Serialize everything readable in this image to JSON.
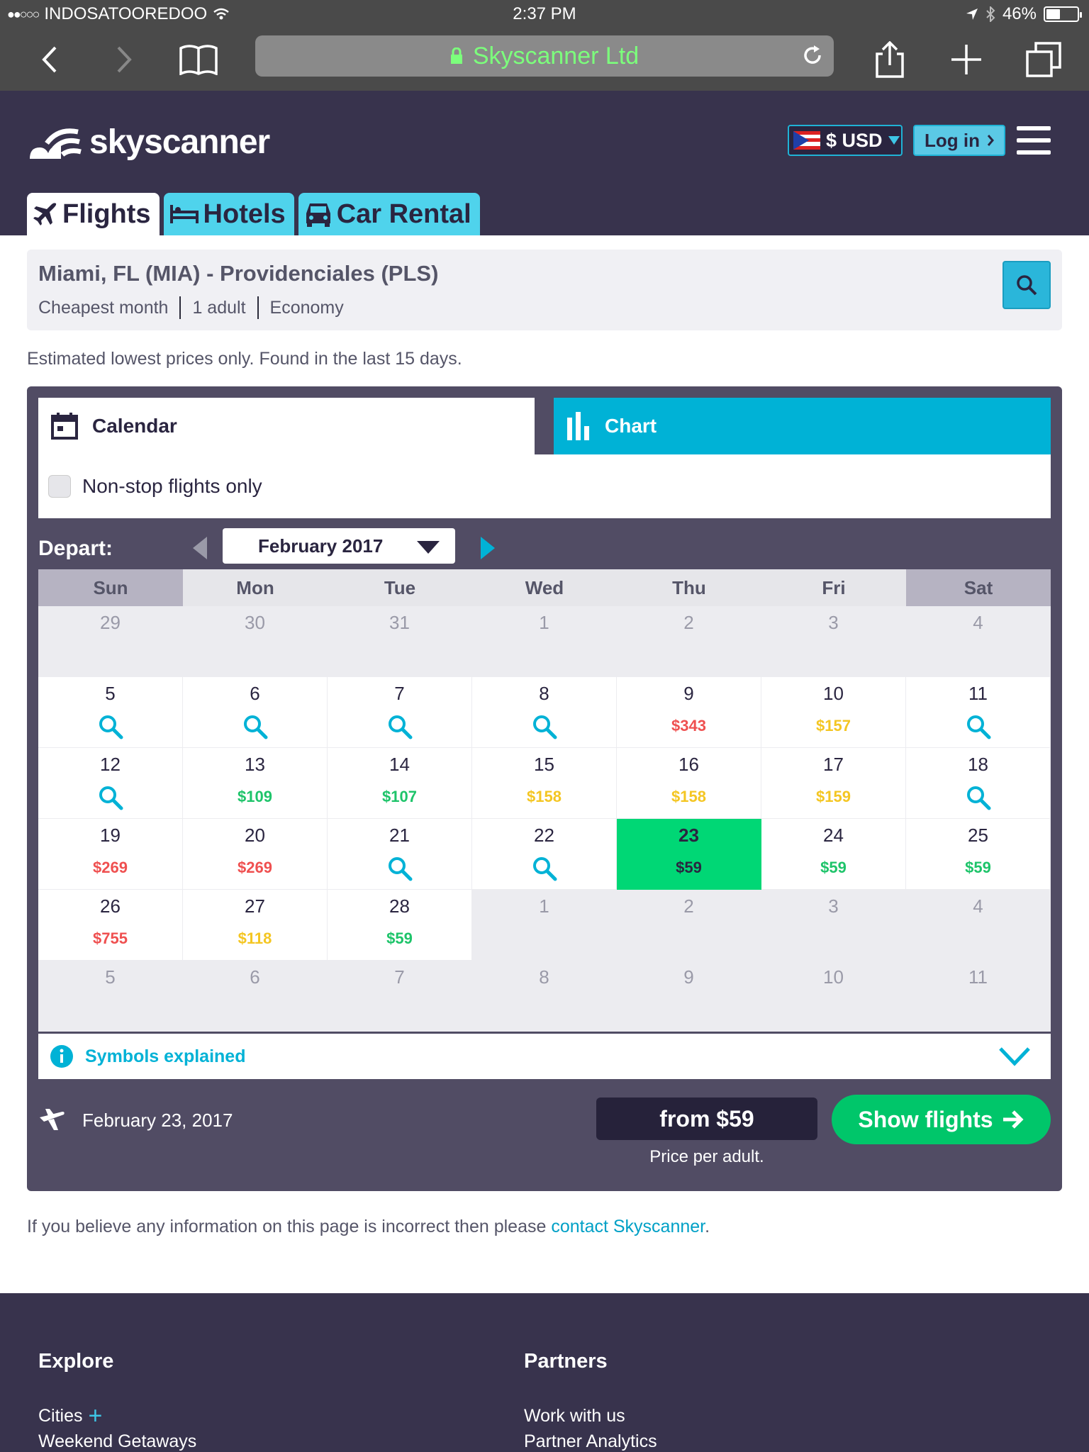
{
  "status": {
    "carrier": "INDOSATOOREDOO",
    "time": "2:37 PM",
    "battery": "46%",
    "battery_level": 0.46
  },
  "browser": {
    "url_title": "Skyscanner Ltd"
  },
  "header": {
    "logo_text": "skyscanner",
    "currency_label": "$ USD",
    "login_label": "Log in",
    "tabs": [
      {
        "label": "Flights",
        "active": true
      },
      {
        "label": "Hotels",
        "active": false
      },
      {
        "label": "Car Rental",
        "active": false
      }
    ]
  },
  "search": {
    "route": "Miami, FL (MIA) - Providenciales (PLS)",
    "when": "Cheapest month",
    "travellers": "1 adult",
    "cabin": "Economy"
  },
  "estimate_note": "Estimated lowest prices only. Found in the last 15 days.",
  "view_tabs": {
    "calendar": "Calendar",
    "chart": "Chart"
  },
  "nonstop_label": "Non-stop flights only",
  "calendar": {
    "depart_label": "Depart:",
    "month": "February 2017",
    "days_of_week": [
      "Sun",
      "Mon",
      "Tue",
      "Wed",
      "Thu",
      "Fri",
      "Sat"
    ],
    "weeks": [
      [
        {
          "day": "29",
          "other": true
        },
        {
          "day": "30",
          "other": true
        },
        {
          "day": "31",
          "other": true
        },
        {
          "day": "1",
          "other": true
        },
        {
          "day": "2",
          "other": true
        },
        {
          "day": "3",
          "other": true
        },
        {
          "day": "4",
          "other": true
        }
      ],
      [
        {
          "day": "5",
          "search": true
        },
        {
          "day": "6",
          "search": true
        },
        {
          "day": "7",
          "search": true
        },
        {
          "day": "8",
          "search": true
        },
        {
          "day": "9",
          "price": "$343",
          "level": "red"
        },
        {
          "day": "10",
          "price": "$157",
          "level": "yel"
        },
        {
          "day": "11",
          "search": true
        }
      ],
      [
        {
          "day": "12",
          "search": true
        },
        {
          "day": "13",
          "price": "$109",
          "level": "grn"
        },
        {
          "day": "14",
          "price": "$107",
          "level": "grn"
        },
        {
          "day": "15",
          "price": "$158",
          "level": "yel"
        },
        {
          "day": "16",
          "price": "$158",
          "level": "yel"
        },
        {
          "day": "17",
          "price": "$159",
          "level": "yel"
        },
        {
          "day": "18",
          "search": true
        }
      ],
      [
        {
          "day": "19",
          "price": "$269",
          "level": "red"
        },
        {
          "day": "20",
          "price": "$269",
          "level": "red"
        },
        {
          "day": "21",
          "search": true
        },
        {
          "day": "22",
          "search": true
        },
        {
          "day": "23",
          "price": "$59",
          "level": "grn",
          "selected": true
        },
        {
          "day": "24",
          "price": "$59",
          "level": "grn"
        },
        {
          "day": "25",
          "price": "$59",
          "level": "grn"
        }
      ],
      [
        {
          "day": "26",
          "price": "$755",
          "level": "red"
        },
        {
          "day": "27",
          "price": "$118",
          "level": "yel"
        },
        {
          "day": "28",
          "price": "$59",
          "level": "grn"
        },
        {
          "day": "1",
          "other": true
        },
        {
          "day": "2",
          "other": true
        },
        {
          "day": "3",
          "other": true
        },
        {
          "day": "4",
          "other": true
        }
      ],
      [
        {
          "day": "5",
          "other": true
        },
        {
          "day": "6",
          "other": true
        },
        {
          "day": "7",
          "other": true
        },
        {
          "day": "8",
          "other": true
        },
        {
          "day": "9",
          "other": true
        },
        {
          "day": "10",
          "other": true
        },
        {
          "day": "11",
          "other": true
        }
      ]
    ]
  },
  "symbols_label": "Symbols explained",
  "selection": {
    "date": "February 23, 2017",
    "from_price": "from $59",
    "price_note": "Price per adult.",
    "show_flights": "Show flights"
  },
  "incorrect": {
    "text": "If you believe any information on this page is incorrect then please ",
    "link": "contact Skyscanner",
    "end": "."
  },
  "footer": {
    "explore_title": "Explore",
    "explore_links": [
      "Cities",
      "Weekend Getaways"
    ],
    "partners_title": "Partners",
    "partners_links": [
      "Work with us",
      "Partner Analytics"
    ]
  },
  "colors": {
    "brand_dark": "#38334d",
    "accent_cyan": "#00b2d6",
    "price_red": "#ef5050",
    "price_yellow": "#f4c623",
    "price_green": "#1ec46a",
    "selected_green": "#00d775"
  }
}
